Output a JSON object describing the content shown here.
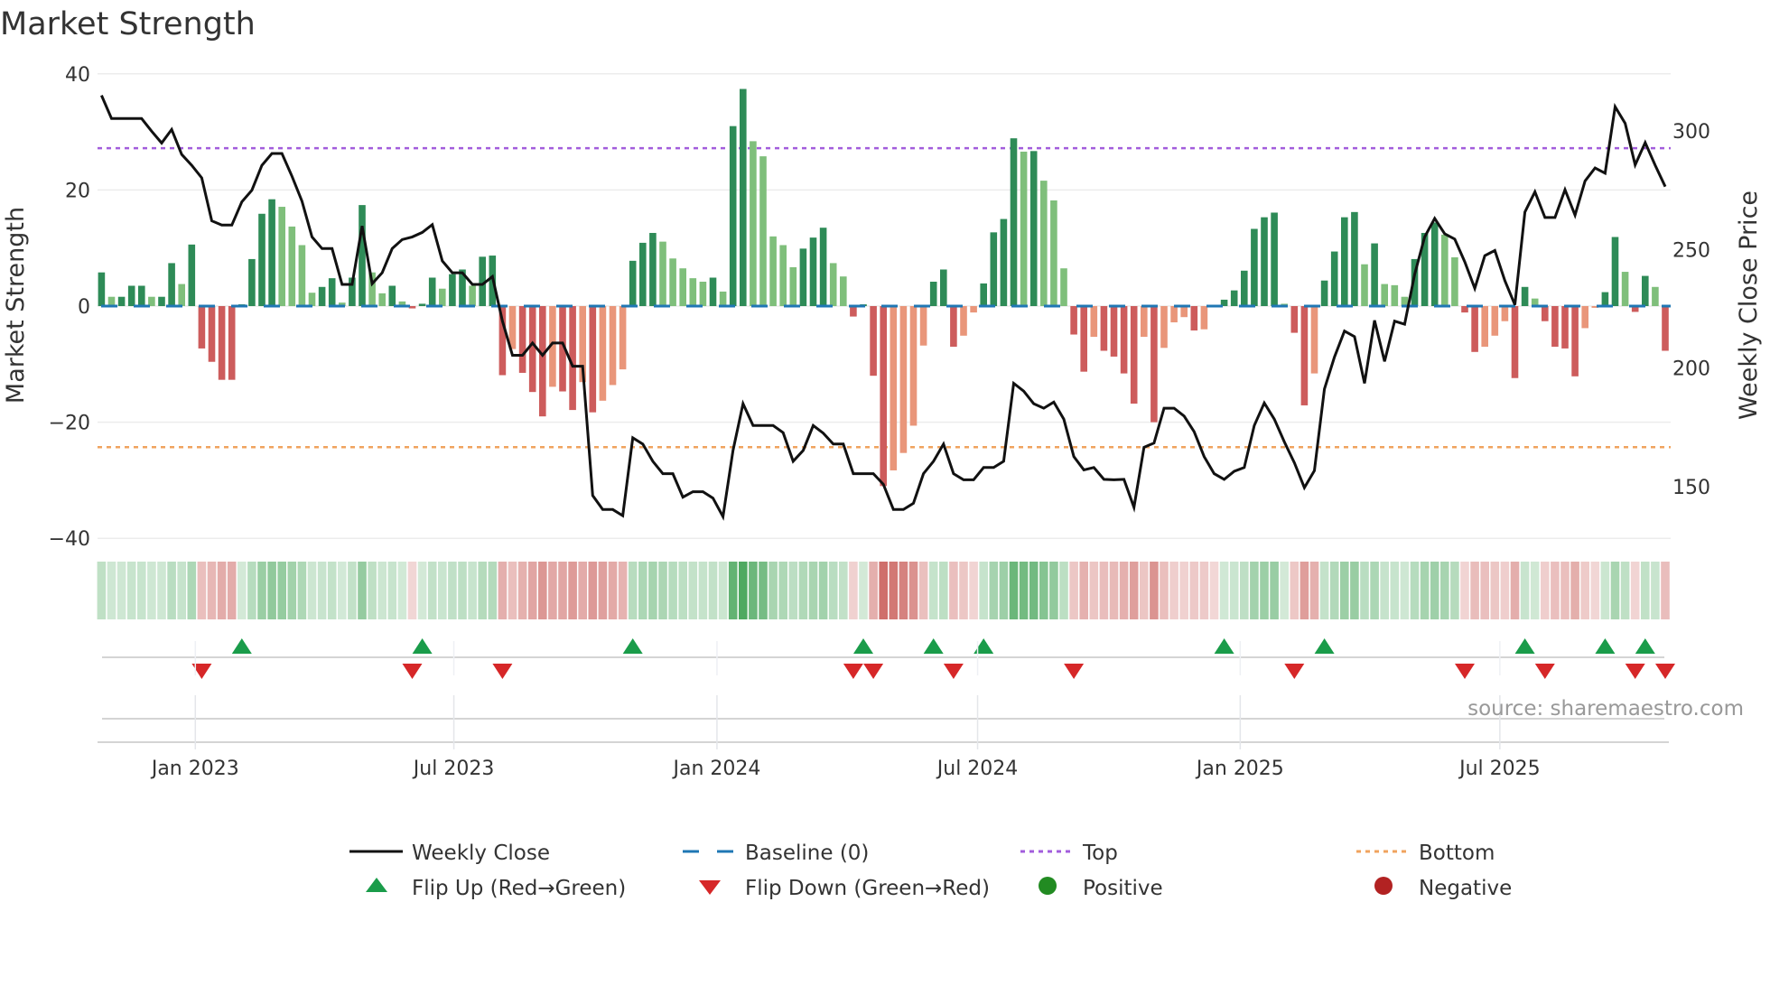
{
  "chart_data": {
    "type": "bar",
    "title": "Market Strength",
    "ylabel": "Market Strength",
    "y2label": "Weekly Close Price",
    "ylim": [
      -40,
      40
    ],
    "y2lim": [
      128,
      320
    ],
    "yticks": [
      {
        "v": 40,
        "label": "40"
      },
      {
        "v": 20,
        "label": "20"
      },
      {
        "v": 0,
        "label": "0"
      },
      {
        "v": -20,
        "label": "−20"
      },
      {
        "v": -40,
        "label": "−40"
      }
    ],
    "y2ticks": [
      {
        "v": 300,
        "label": "300"
      },
      {
        "v": 250,
        "label": "250"
      },
      {
        "v": 200,
        "label": "200"
      },
      {
        "v": 150,
        "label": "150"
      }
    ],
    "xticks": [
      {
        "week": 9.36,
        "label": "Jan 2023"
      },
      {
        "week": 35.15,
        "label": "Jul 2023"
      },
      {
        "week": 61.4,
        "label": "Jan 2024"
      },
      {
        "week": 87.4,
        "label": "Jul 2024"
      },
      {
        "week": 113.6,
        "label": "Jan 2025"
      },
      {
        "week": 139.5,
        "label": "Jul 2025"
      }
    ],
    "grid": true,
    "top_level": 27.2,
    "bottom_level": -24.3,
    "baseline": 0,
    "strength": [
      5.8,
      1.6,
      1.6,
      3.5,
      3.5,
      1.6,
      1.6,
      7.4,
      3.8,
      10.6,
      -7.3,
      -9.6,
      -12.7,
      -12.7,
      0.3,
      8.1,
      15.9,
      18.4,
      17.1,
      13.7,
      10.5,
      2.3,
      3.3,
      4.8,
      0.6,
      4.9,
      17.4,
      5.8,
      2.2,
      3.5,
      0.8,
      -0.4,
      0.4,
      4.9,
      3.0,
      5.5,
      6.3,
      3.5,
      8.5,
      8.7,
      -11.9,
      -7.4,
      -11.5,
      -14.8,
      -19,
      -13.9,
      -14.7,
      -17.9,
      -13.1,
      -18.3,
      -16.3,
      -13.6,
      -10.9,
      7.8,
      10.9,
      12.6,
      11.1,
      8.2,
      6.5,
      4.8,
      4.2,
      4.9,
      2.5,
      31,
      37.4,
      28.4,
      25.8,
      12,
      10.5,
      6.7,
      9.9,
      11.8,
      13.5,
      7.4,
      5.1,
      -1.8,
      0.3,
      -12,
      -31,
      -28.3,
      -25.3,
      -20.6,
      -6.8,
      4.2,
      6.3,
      -7,
      -5.1,
      -1.1,
      3.9,
      12.7,
      15,
      28.9,
      26.6,
      26.7,
      21.6,
      18.2,
      6.5,
      -4.9,
      -11.3,
      -5.3,
      -7.7,
      -8.7,
      -11.6,
      -16.8,
      -5.3,
      -20,
      -7.2,
      -2.8,
      -1.9,
      -4.2,
      -4,
      -0.2,
      1.1,
      2.7,
      6.1,
      13.3,
      15.3,
      16.1,
      0.4,
      -4.6,
      -17.1,
      -11.6,
      4.4,
      9.4,
      15.3,
      16.2,
      7.2,
      10.8,
      3.8,
      3.6,
      1.6,
      8.1,
      12.6,
      14.4,
      12.3,
      8.4,
      -1.1,
      -7.9,
      -7,
      -5.1,
      -2.6,
      -12.4,
      3.3,
      1.3,
      -2.6,
      -7,
      -7.3,
      -12.1,
      -3.8,
      -0.3,
      2.4,
      11.9,
      5.9,
      -1,
      5.2,
      3.3,
      -7.7
    ],
    "weekly_close": [
      315.0,
      305.2,
      305.2,
      305.2,
      305.2,
      299.9,
      294.9,
      300.6,
      290.1,
      285.5,
      280.2,
      262.1,
      260.3,
      260.3,
      270.1,
      275.0,
      285.5,
      290.5,
      290.5,
      280.9,
      270.4,
      255.3,
      250.4,
      250.4,
      235.3,
      235.3,
      259.9,
      235.6,
      240.2,
      250.4,
      254.2,
      255.3,
      257.2,
      260.5,
      245.2,
      240.2,
      240.2,
      235.3,
      235.3,
      238.6,
      219.8,
      205.4,
      205.4,
      210.6,
      205.4,
      210.6,
      210.6,
      200.8,
      200.8,
      146.3,
      140.4,
      140.4,
      137.8,
      170.6,
      168,
      160.7,
      155.5,
      155.5,
      145.6,
      147.9,
      147.9,
      145.2,
      137.4,
      165.3,
      185,
      175.8,
      175.8,
      175.8,
      172.8,
      160.7,
      165.3,
      175.8,
      172.6,
      168,
      168,
      155.5,
      155.5,
      155.5,
      151,
      140.4,
      140.4,
      143,
      155.5,
      160.7,
      168,
      155.5,
      152.9,
      152.9,
      158.1,
      158.1,
      160.7,
      193.6,
      190.3,
      185,
      183.1,
      185.7,
      178.5,
      162.7,
      157.1,
      158.1,
      153.1,
      152.9,
      153.1,
      141.3,
      166.6,
      168.4,
      183.1,
      183.1,
      179.8,
      173.2,
      162.7,
      155.5,
      153.1,
      156.5,
      158.1,
      175.8,
      185.3,
      178.5,
      168.9,
      160.1,
      149.6,
      156.8,
      191.2,
      204.7,
      215.6,
      213.3,
      193.6,
      220.1,
      202.8,
      219.8,
      218.5,
      239.5,
      255.3,
      263.1,
      256.6,
      254.4,
      244.8,
      233.6,
      247.4,
      249.6,
      236.9,
      226.7,
      265.8,
      274.3,
      263.5,
      263.5,
      275.2,
      264.5,
      278.9,
      284.4,
      282.2,
      310.2,
      303.2,
      285.7,
      295.1,
      285.5,
      276.5
    ],
    "legend": {
      "placement": "bottom",
      "items": [
        {
          "label": "Weekly Close",
          "kind": "line"
        },
        {
          "label": "Baseline (0)",
          "kind": "dash"
        },
        {
          "label": "Top",
          "kind": "dot-purple"
        },
        {
          "label": "Bottom",
          "kind": "dot-orange"
        },
        {
          "label": "Flip Up (Red→Green)",
          "kind": "tri-up"
        },
        {
          "label": "Flip Down (Green→Red)",
          "kind": "tri-down"
        },
        {
          "label": "Positive",
          "kind": "circle-green"
        },
        {
          "label": "Negative",
          "kind": "circle-red"
        }
      ]
    },
    "source": "source: sharemaestro.com"
  },
  "colors": {
    "rising_positive": "#2e8b57",
    "falling_positive": "#7fbf7b",
    "falling_negative": "#cd5c5c",
    "rising_negative": "#e9967a",
    "baseline": "#1f77b4",
    "top": "#a25ddc",
    "bottom": "#f0a35e",
    "line": "#111111",
    "flip_up": "#1a9c4a",
    "flip_down": "#d62728",
    "positive": "#228b22",
    "negative": "#b22222"
  }
}
